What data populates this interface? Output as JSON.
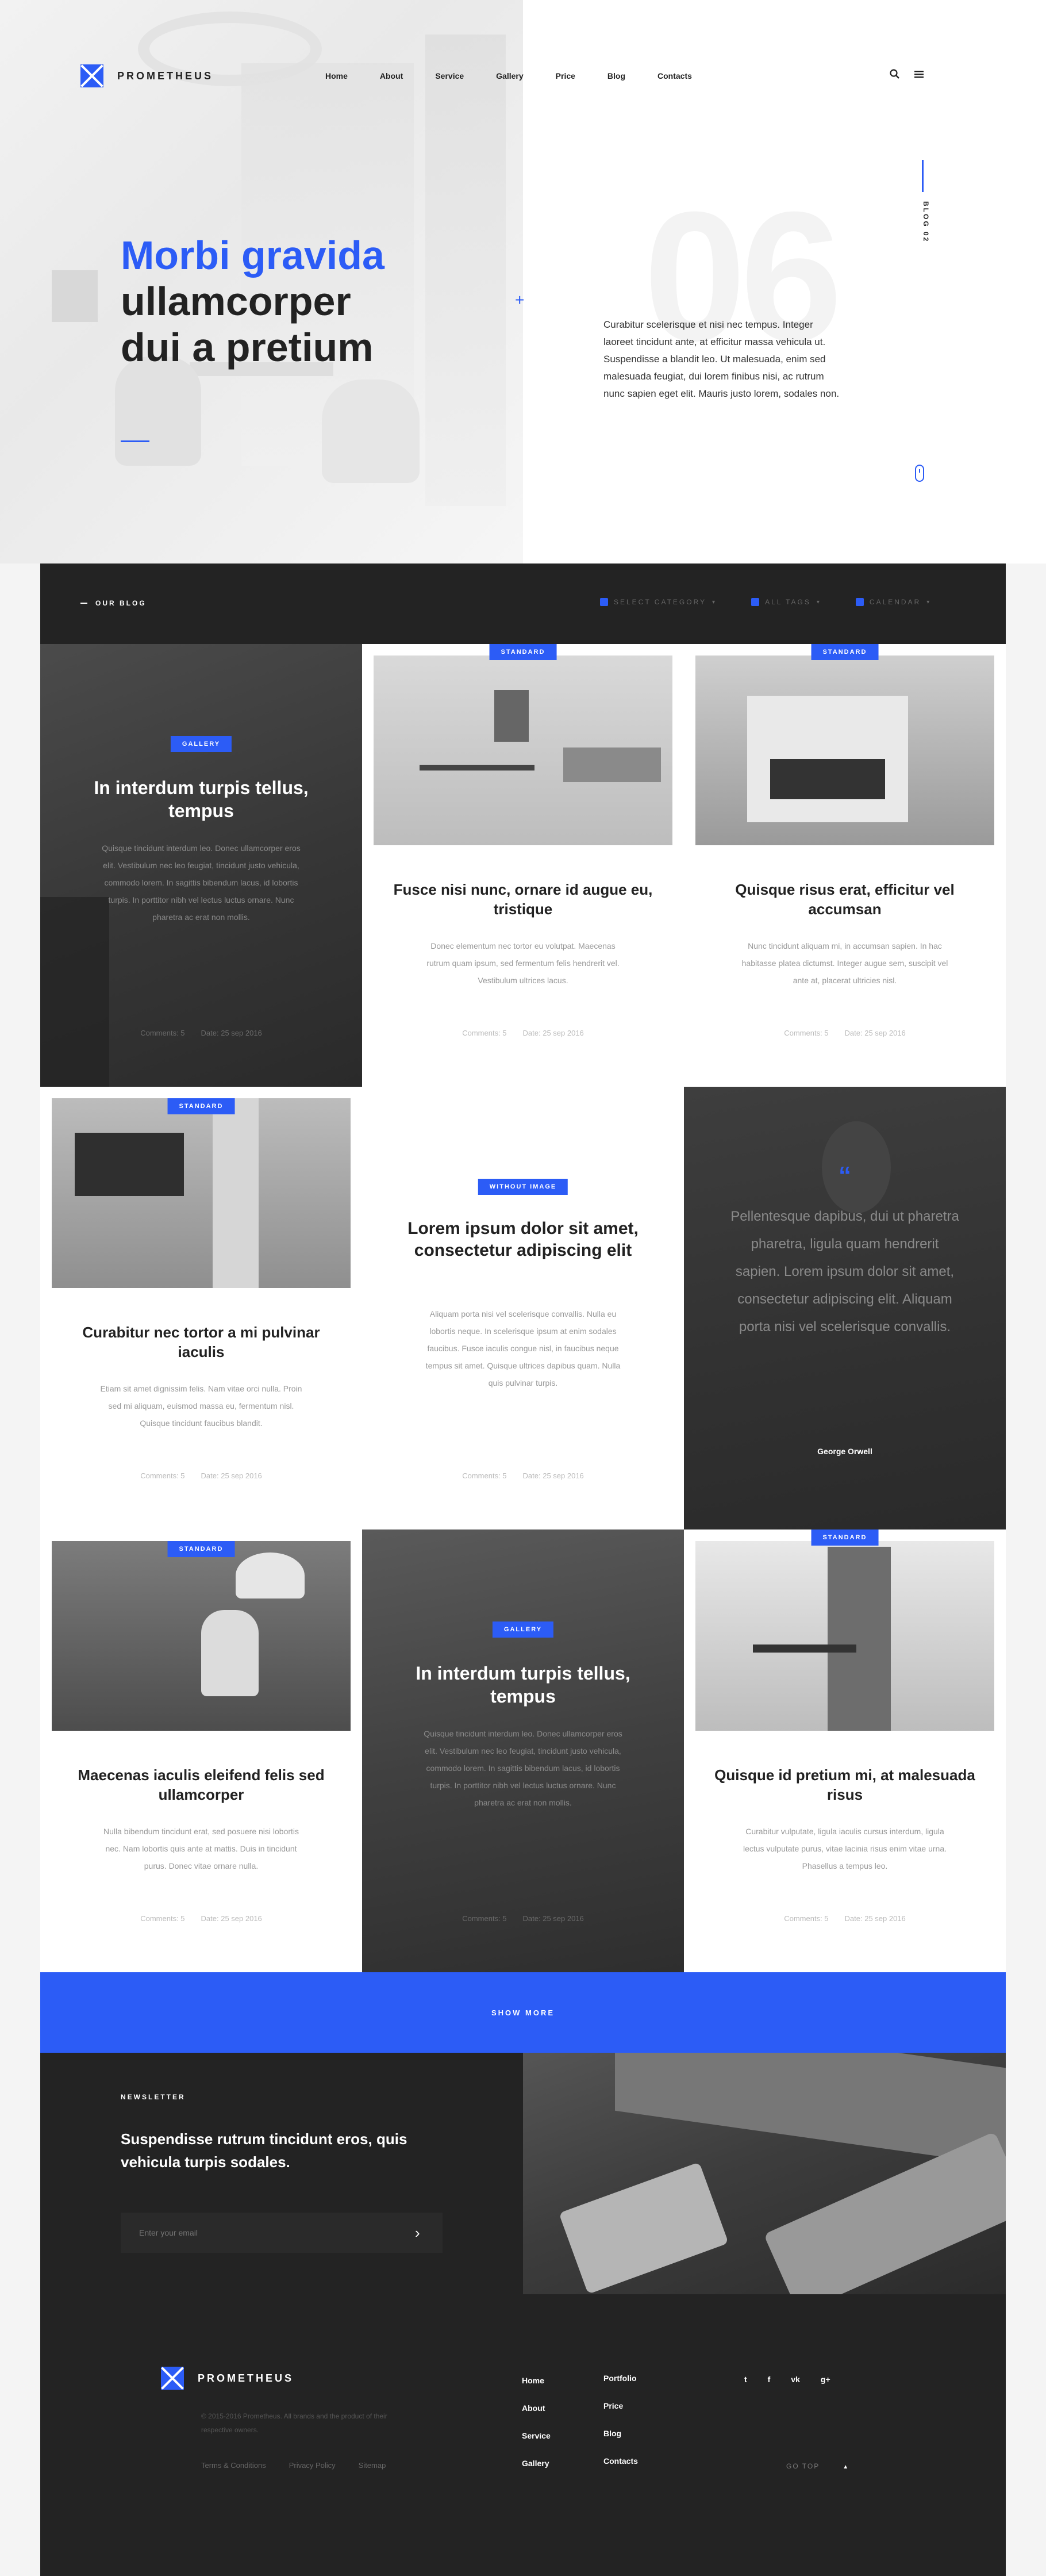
{
  "brand": {
    "name": "PROMETHEUS",
    "color": "#2c5cf6"
  },
  "nav": [
    "Home",
    "About",
    "Service",
    "Gallery",
    "Price",
    "Blog",
    "Contacts"
  ],
  "header_icons": {
    "search": "search-icon",
    "menu": "menu-icon"
  },
  "hero": {
    "title_blue": "Morbi gravida",
    "title_line2": "ullamcorper",
    "title_line3": "dui a pretium",
    "big_number": "06",
    "side_label": "BLOG 02",
    "text": "Curabitur scelerisque et nisi nec tempus. Integer laoreet tincidunt ante, at efficitur massa vehicula ut. Suspendisse a blandit leo. Ut malesuada, enim sed malesuada feugiat, dui lorem finibus nisi, ac rutrum nunc sapien eget elit. Mauris justo lorem, sodales non."
  },
  "blog_bar": {
    "title": "OUR BLOG",
    "filters": [
      "SELECT CATEGORY",
      "ALL TAGS",
      "CALENDAR"
    ]
  },
  "cards": [
    {
      "badge": "GALLERY",
      "title": "In interdum turpis tellus, tempus",
      "text": "Quisque tincidunt interdum leo. Donec ullamcorper eros elit. Vestibulum nec leo feugiat, tincidunt justo vehicula, commodo lorem. In sagittis bibendum lacus, id lobortis turpis. In porttitor nibh vel lectus luctus ornare. Nunc pharetra ac erat non mollis.",
      "comments": "Comments: 5",
      "date": "Date: 25 sep 2016"
    },
    {
      "badge": "STANDARD",
      "title": "Fusce nisi nunc, ornare id augue eu, tristique",
      "text": "Donec elementum nec tortor eu volutpat. Maecenas rutrum quam ipsum, sed fermentum felis hendrerit vel. Vestibulum ultrices lacus.",
      "comments": "Comments: 5",
      "date": "Date: 25 sep 2016"
    },
    {
      "badge": "STANDARD",
      "title": "Quisque risus erat, efficitur vel accumsan",
      "text": "Nunc tincidunt aliquam mi, in accumsan sapien. In hac habitasse platea dictumst. Integer augue sem, suscipit vel ante at, placerat ultricies nisl.",
      "comments": "Comments: 5",
      "date": "Date: 25 sep 2016"
    },
    {
      "badge": "STANDARD",
      "title": "Curabitur nec tortor a mi pulvinar iaculis",
      "text": "Etiam sit amet dignissim felis. Nam vitae orci nulla. Proin sed mi aliquam, euismod massa eu, fermentum nisl. Quisque tincidunt faucibus blandit.",
      "comments": "Comments: 5",
      "date": "Date: 25 sep 2016"
    },
    {
      "badge": "WITHOUT IMAGE",
      "title": "Lorem ipsum dolor sit amet, consectetur adipiscing elit",
      "text": "Aliquam porta nisi vel scelerisque convallis. Nulla eu lobortis neque. In scelerisque ipsum at enim sodales faucibus. Fusce iaculis congue nisl, in faucibus neque tempus sit amet. Quisque ultrices dapibus quam. Nulla quis pulvinar turpis.",
      "comments": "Comments: 5",
      "date": "Date: 25 sep 2016"
    },
    {
      "quote": "Pellentesque dapibus, dui ut pharetra pharetra, ligula quam hendrerit sapien. Lorem ipsum dolor sit amet, consectetur adipiscing elit. Aliquam porta nisi vel scelerisque convallis.",
      "author": "George Orwell"
    },
    {
      "badge": "STANDARD",
      "title": "Maecenas iaculis eleifend felis sed ullamcorper",
      "text": "Nulla bibendum tincidunt erat, sed posuere nisi lobortis nec. Nam lobortis quis ante at mattis. Duis in tincidunt purus. Donec vitae ornare nulla.",
      "comments": "Comments: 5",
      "date": "Date: 25 sep 2016"
    },
    {
      "badge": "GALLERY",
      "title": "In interdum turpis tellus, tempus",
      "text": "Quisque tincidunt interdum leo. Donec ullamcorper eros elit. Vestibulum nec leo feugiat, tincidunt justo vehicula, commodo lorem. In sagittis bibendum lacus, id lobortis turpis. In porttitor nibh vel lectus luctus ornare. Nunc pharetra ac erat non mollis.",
      "comments": "Comments: 5",
      "date": "Date: 25 sep 2016"
    },
    {
      "badge": "STANDARD",
      "title": "Quisque id pretium mi, at malesuada risus",
      "text": "Curabitur vulputate, ligula iaculis cursus interdum, ligula lectus vulputate purus, vitae lacinia risus enim vitae urna. Phasellus a tempus leo.",
      "comments": "Comments: 5",
      "date": "Date: 25 sep 2016"
    }
  ],
  "show_more": "SHOW MORE",
  "newsletter": {
    "label": "NEWSLETTER",
    "title": "Suspendisse rutrum tincidunt eros, quis vehicula turpis sodales.",
    "placeholder": "Enter your email"
  },
  "footer": {
    "brand": "PROMETHEUS",
    "copyright": "© 2015-2016 Prometheus. All brands and the product of their respective owners.",
    "legal": [
      "Terms & Conditions",
      "Privacy Policy",
      "Sitemap"
    ],
    "col1": [
      "Home",
      "About",
      "Service",
      "Gallery"
    ],
    "col2": [
      "Portfolio",
      "Price",
      "Blog",
      "Contacts"
    ],
    "social": [
      "twitter-icon",
      "facebook-icon",
      "vk-icon",
      "google-plus-icon"
    ],
    "go_top": "GO TOP"
  }
}
